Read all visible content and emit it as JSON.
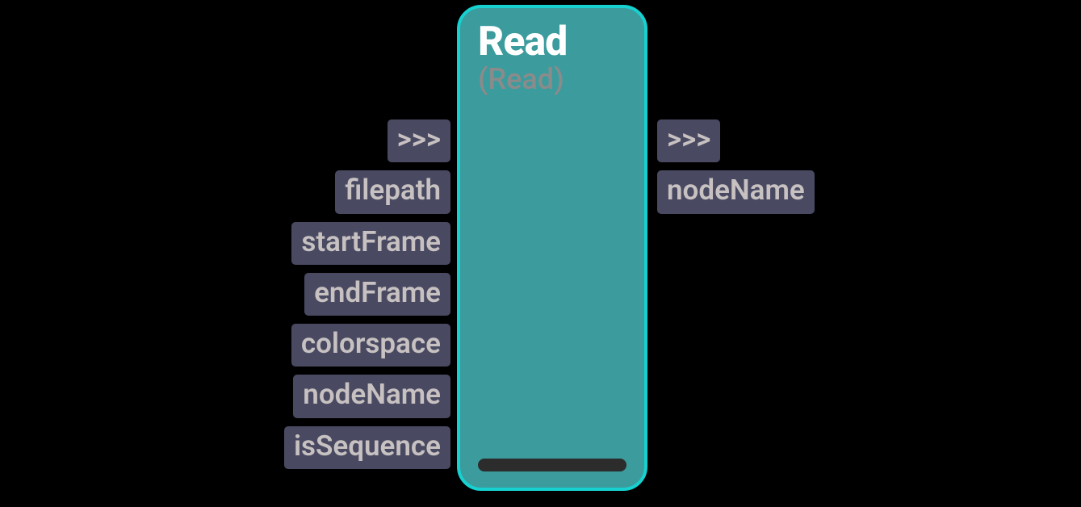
{
  "node": {
    "title": "Read",
    "subtitle": "(Read)"
  },
  "inputs": [
    {
      "label": ">>>"
    },
    {
      "label": "filepath"
    },
    {
      "label": "startFrame"
    },
    {
      "label": "endFrame"
    },
    {
      "label": "colorspace"
    },
    {
      "label": "nodeName"
    },
    {
      "label": "isSequence"
    }
  ],
  "outputs": [
    {
      "label": ">>>"
    },
    {
      "label": "nodeName"
    }
  ]
}
